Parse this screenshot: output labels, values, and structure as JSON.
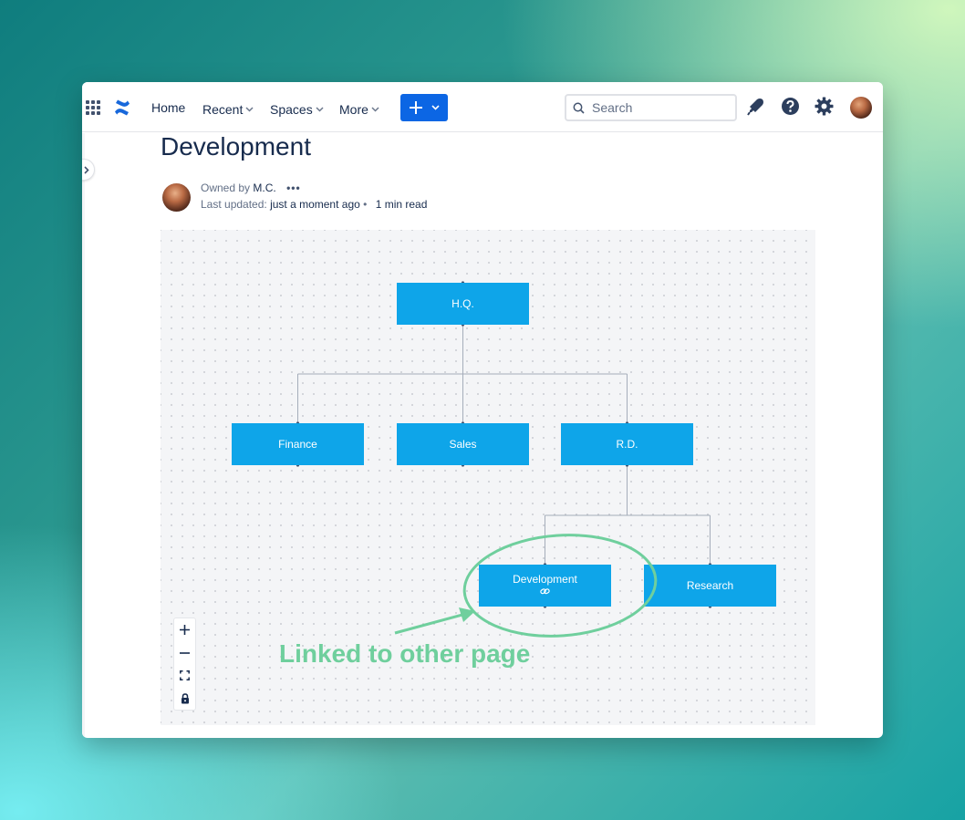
{
  "nav": {
    "home": "Home",
    "recent": "Recent",
    "spaces": "Spaces",
    "more": "More",
    "search_placeholder": "Search"
  },
  "page": {
    "title": "Development",
    "owned_by_label": "Owned by",
    "owner": "M.C.",
    "more_actions": "•••",
    "last_updated_label": "Last updated:",
    "last_updated_value": "just a moment ago",
    "separator": "•",
    "read_time": "1 min read"
  },
  "diagram": {
    "nodes": {
      "hq": "H.Q.",
      "finance": "Finance",
      "sales": "Sales",
      "rd": "R.D.",
      "development": "Development",
      "research": "Research"
    },
    "link_icon": "link-icon"
  },
  "annotation": {
    "text": "Linked to other page",
    "color": "#6fcf9d"
  },
  "colors": {
    "node": "#0ea5e9",
    "primary_button": "#0c66e4",
    "text": "#172b4d"
  }
}
